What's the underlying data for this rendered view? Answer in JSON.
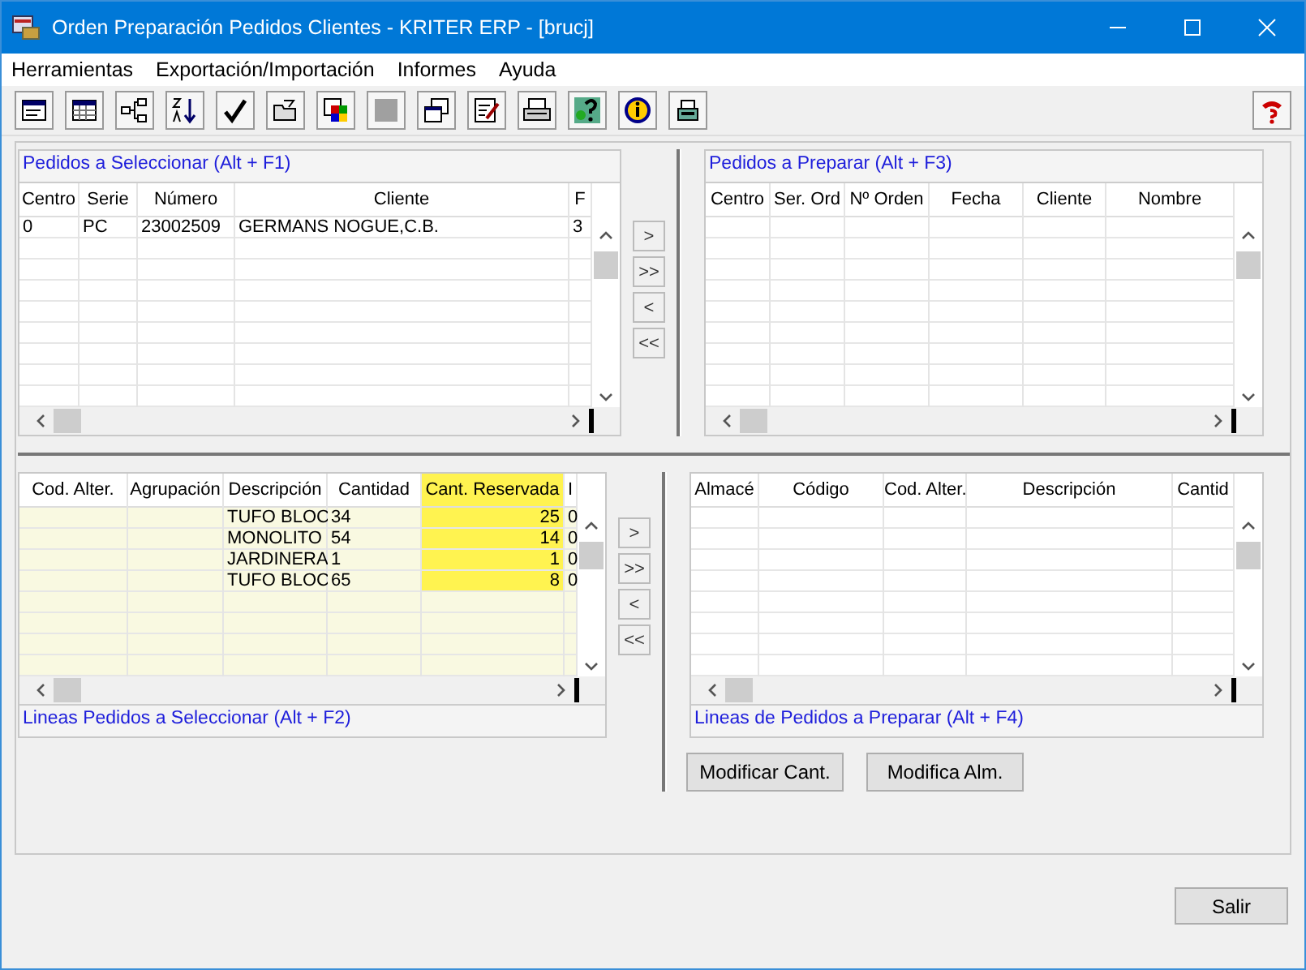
{
  "window": {
    "title": "Orden Preparación Pedidos Clientes - KRITER ERP - [brucj]"
  },
  "menu": [
    "Herramientas",
    "Exportación/Importación",
    "Informes",
    "Ayuda"
  ],
  "grids": [
    {
      "title": "Pedidos a Seleccionar  (Alt + F1)",
      "columns": [
        {
          "label": "Centro",
          "highlighted": false
        },
        {
          "label": "Serie",
          "highlighted": false
        },
        {
          "label": "Número",
          "highlighted": false
        },
        {
          "label": "Cliente",
          "highlighted": false
        },
        {
          "label": "F",
          "highlighted": false
        }
      ],
      "rows": [
        [
          "0",
          "PC",
          "23002509",
          "GERMANS NOGUE,C.B.",
          "3"
        ]
      ]
    },
    {
      "title": "Pedidos a Preparar  (Alt + F3)",
      "columns": [
        {
          "label": "Centro",
          "highlighted": false
        },
        {
          "label": "Ser. Ord",
          "highlighted": false
        },
        {
          "label": "Nº Orden",
          "highlighted": false
        },
        {
          "label": "Fecha",
          "highlighted": false
        },
        {
          "label": "Cliente",
          "highlighted": false
        },
        {
          "label": "Nombre",
          "highlighted": false
        }
      ]
    },
    {
      "title": "Lineas Pedidos a Seleccionar  (Alt + F2)",
      "columns": [
        {
          "label": "Cod. Alter.",
          "highlighted": false
        },
        {
          "label": "Agrupación",
          "highlighted": false
        },
        {
          "label": "Descripción",
          "highlighted": false
        },
        {
          "label": "Cantidad",
          "highlighted": false
        },
        {
          "label": "Cant. Reservada",
          "highlighted": true
        },
        {
          "label": "I",
          "highlighted": false
        }
      ],
      "rows": [
        [
          "",
          "",
          "TUFO BLOC",
          "34",
          "25",
          "0"
        ],
        [
          "",
          "",
          "MONOLITO",
          "54",
          "14",
          "0"
        ],
        [
          "",
          "",
          "JARDINERA",
          "1",
          "1",
          "0"
        ],
        [
          "",
          "",
          "TUFO BLOC",
          "65",
          "8",
          "0"
        ]
      ]
    },
    {
      "title": "Lineas de Pedidos a Preparar  (Alt + F4)",
      "columns": [
        {
          "label": "Almacé",
          "highlighted": false
        },
        {
          "label": "Código",
          "highlighted": false
        },
        {
          "label": "Cod. Alter.",
          "highlighted": false
        },
        {
          "label": "Descripción",
          "highlighted": false
        },
        {
          "label": "Cantid",
          "highlighted": false
        }
      ]
    }
  ],
  "move_buttons": [
    [
      ">",
      ">>",
      "<",
      "<<"
    ],
    [
      ">",
      ">>",
      "<",
      "<<"
    ]
  ],
  "action_buttons": [
    "Modificar Cant.",
    "Modifica Alm."
  ],
  "exit_button": "Salir"
}
